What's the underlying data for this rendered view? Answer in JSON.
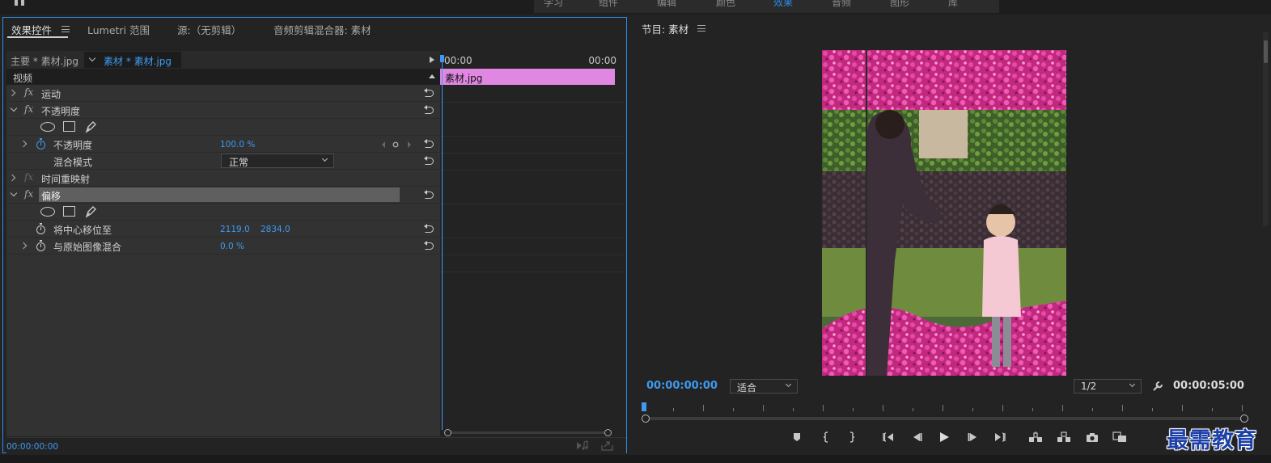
{
  "workspace": {
    "items": [
      "学习",
      "组件",
      "编辑",
      "颜色",
      "效果",
      "音频",
      "图形",
      "库"
    ],
    "active_index": 4
  },
  "effect_controls": {
    "tabs": [
      "效果控件",
      "Lumetri 范围",
      "源:（无剪辑）",
      "音频剪辑混合器: 素材"
    ],
    "active_tab": "效果控件",
    "source": {
      "main_label": "主要 * 素材.jpg",
      "clip_label": "素材 * 素材.jpg"
    },
    "section_video": "视频",
    "effects": {
      "motion": "运动",
      "opacity": "不透明度",
      "opacity_param": "不透明度",
      "opacity_value": "100.0 %",
      "blend_mode_label": "混合模式",
      "blend_mode_value": "正常",
      "time_remap": "时间重映射",
      "offset": "偏移",
      "shift_center_label": "将中心移位至",
      "shift_center_x": "2119.0",
      "shift_center_y": "2834.0",
      "blend_with_original_label": "与原始图像混合",
      "blend_with_original_value": "0.0 %"
    },
    "timeline": {
      "start_tc": "00:00",
      "end_tc": "00:00",
      "clip_name": "素材.jpg"
    },
    "footer_timecode": "00:00:00:00"
  },
  "program_monitor": {
    "title": "节目: 素材",
    "current_timecode": "00:00:00:00",
    "zoom": "适合",
    "resolution": "1/2",
    "duration_timecode": "00:00:05:00"
  },
  "watermark": "最需教育",
  "colors": {
    "accent": "#2d8ceb",
    "clip_bar": "#e087e2",
    "timecode": "#3e9af0"
  }
}
